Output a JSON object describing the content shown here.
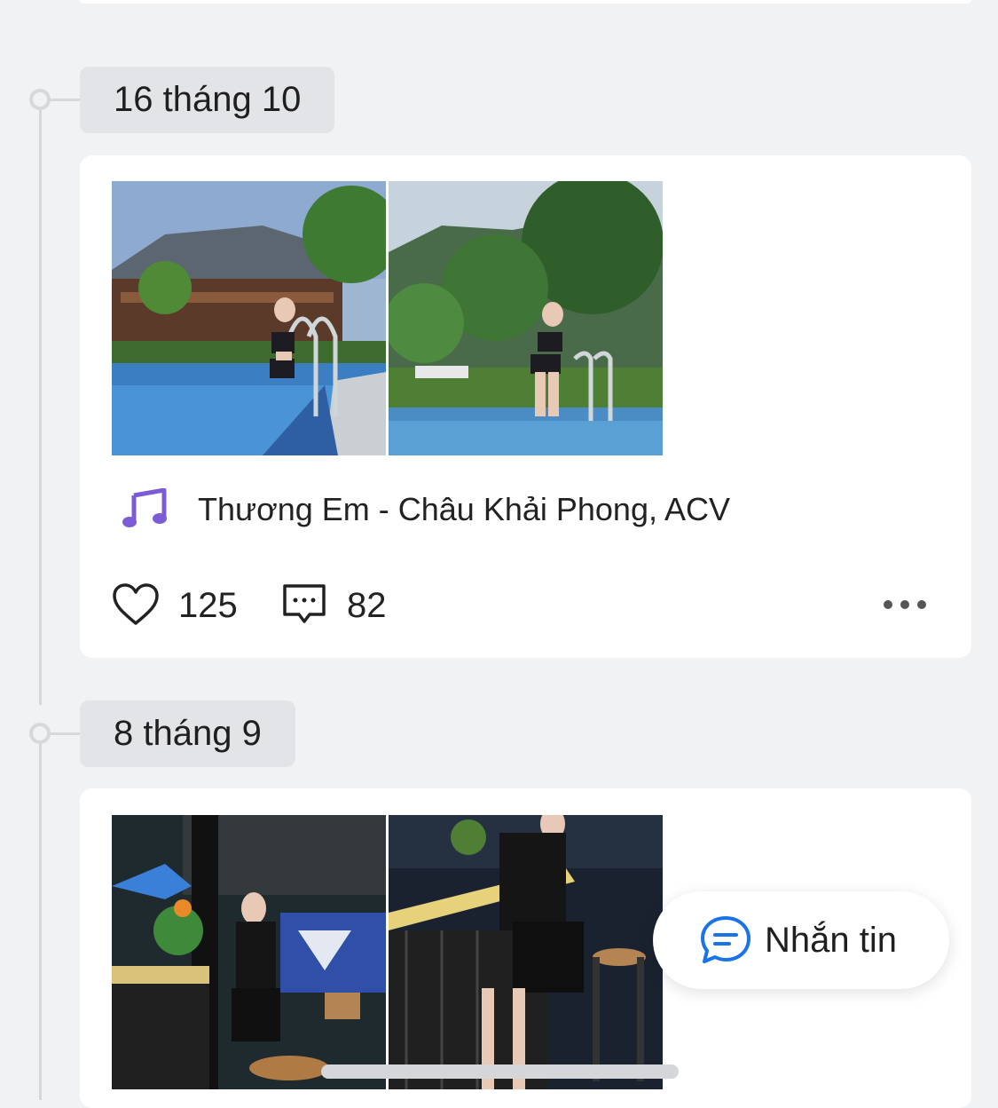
{
  "posts": [
    {
      "date": "16 tháng 10",
      "images": [
        {
          "alt": "Ảnh hồ bơi trước nhà sàn"
        },
        {
          "alt": "Ảnh hồ bơi giữa cây xanh"
        }
      ],
      "music": "Thương Em - Châu Khải Phong, ACV",
      "likes": "125",
      "comments": "82"
    },
    {
      "date": "8 tháng 9",
      "images": [
        {
          "alt": "Ảnh quán cà phê ban đêm"
        },
        {
          "alt": "Ảnh quầy bar ban đêm"
        }
      ]
    }
  ],
  "fab": {
    "label": "Nhắn tin"
  },
  "colors": {
    "background": "#f1f2f4",
    "card": "#ffffff",
    "chip": "#e3e4e7",
    "music_icon": "#7b5cd6",
    "message_icon": "#1a73e8"
  },
  "icons": [
    "music-note-icon",
    "heart-icon",
    "comment-icon",
    "more-icon",
    "chat-bubble-icon"
  ]
}
